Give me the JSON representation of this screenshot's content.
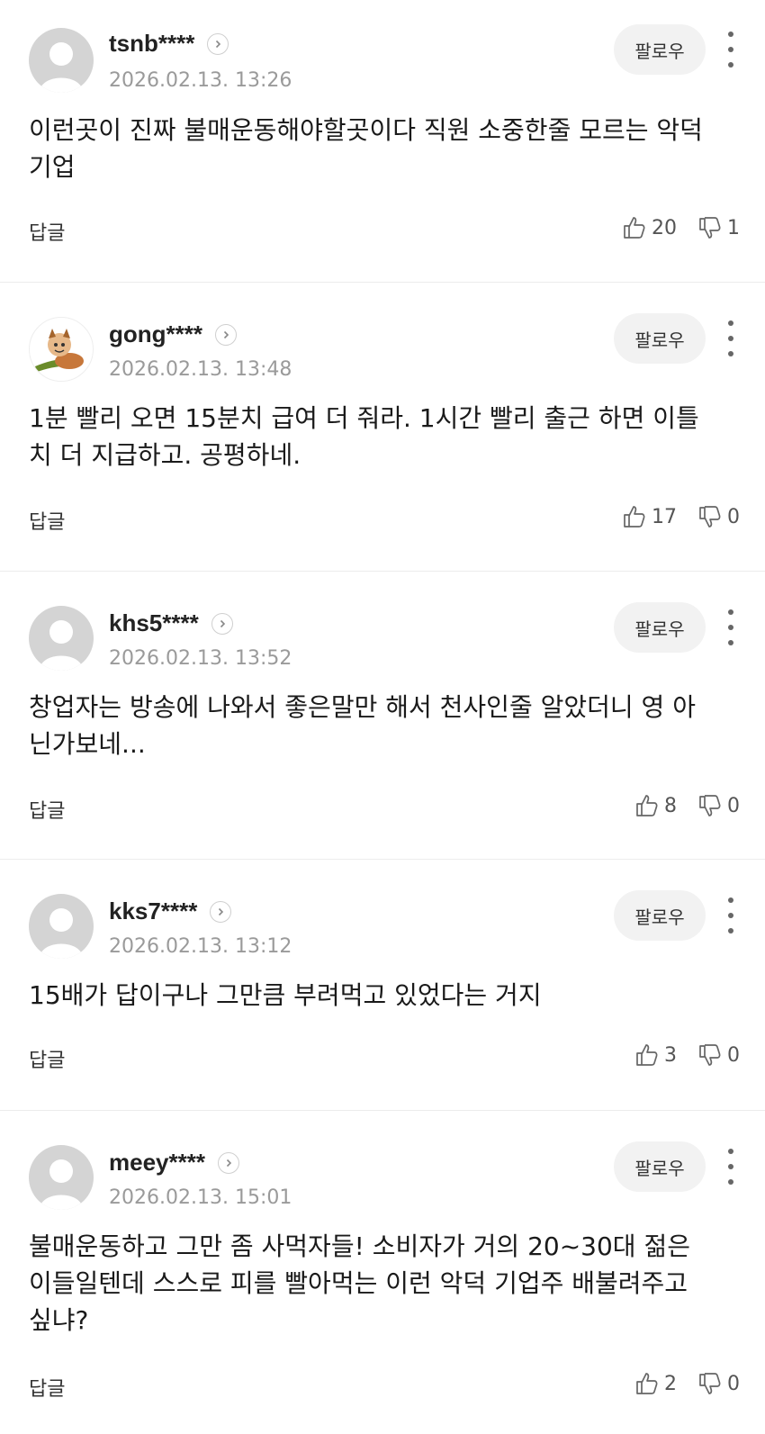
{
  "comments": [
    {
      "nick": "tsnb****",
      "date": "2026.02.13. 13:26",
      "follow": "팔로우",
      "body": "이런곳이 진짜 불매운동해야할곳이다 직원 소중한줄 모르는 악덕기업",
      "reply": "답글",
      "likes": "20",
      "dislikes": "1",
      "avatar": "default"
    },
    {
      "nick": "gong****",
      "date": "2026.02.13. 13:48",
      "follow": "팔로우",
      "body": "1분 빨리 오면 15분치 급여 더 줘라. 1시간 빨리 출근 하면 이틀치 더 지급하고. 공평하네.",
      "reply": "답글",
      "likes": "17",
      "dislikes": "0",
      "avatar": "cartoon"
    },
    {
      "nick": "khs5****",
      "date": "2026.02.13. 13:52",
      "follow": "팔로우",
      "body": "창업자는 방송에 나와서 좋은말만 해서 천사인줄 알았더니 영 아닌가보네...",
      "reply": "답글",
      "likes": "8",
      "dislikes": "0",
      "avatar": "default"
    },
    {
      "nick": "kks7****",
      "date": "2026.02.13. 13:12",
      "follow": "팔로우",
      "body": "15배가 답이구나 그만큼 부려먹고 있었다는 거지",
      "reply": "답글",
      "likes": "3",
      "dislikes": "0",
      "avatar": "default"
    },
    {
      "nick": "meey****",
      "date": "2026.02.13. 15:01",
      "follow": "팔로우",
      "body": "불매운동하고 그만 좀 사먹자들! 소비자가 거의 20~30대 젊은이들일텐데 스스로 피를 빨아먹는 이런 악덕 기업주 배불려주고 싶냐?",
      "reply": "답글",
      "likes": "2",
      "dislikes": "0",
      "avatar": "default"
    }
  ]
}
